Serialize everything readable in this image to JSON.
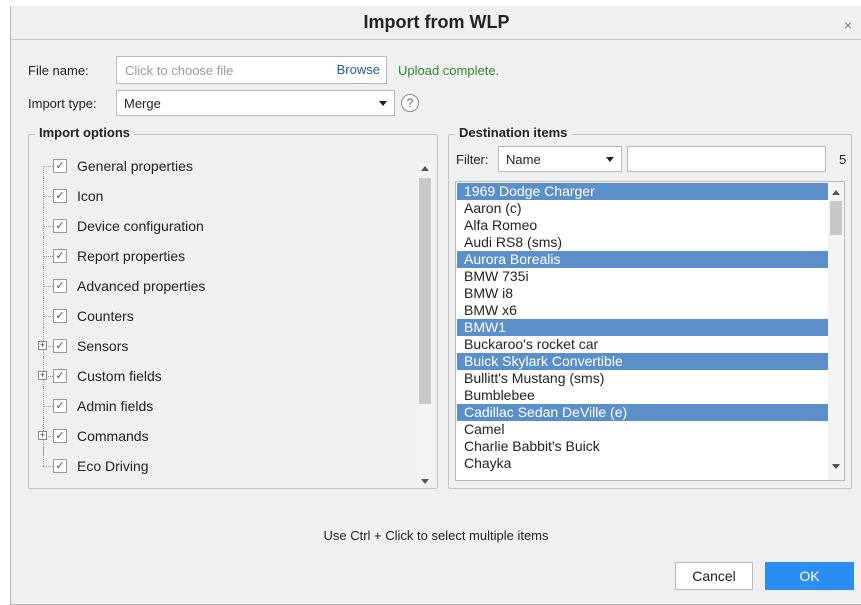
{
  "dialog": {
    "title": "Import from WLP",
    "close_label": "×"
  },
  "file": {
    "label": "File name:",
    "placeholder": "Click to choose file",
    "browse_label": "Browse",
    "status": "Upload complete."
  },
  "import_type": {
    "label": "Import type:",
    "value": "Merge",
    "help_label": "?"
  },
  "import_options": {
    "legend": "Import options",
    "items": [
      {
        "label": "General properties",
        "checked": true,
        "expandable": false
      },
      {
        "label": "Icon",
        "checked": true,
        "expandable": false
      },
      {
        "label": "Device configuration",
        "checked": true,
        "expandable": false
      },
      {
        "label": "Report properties",
        "checked": true,
        "expandable": false
      },
      {
        "label": "Advanced properties",
        "checked": true,
        "expandable": false
      },
      {
        "label": "Counters",
        "checked": true,
        "expandable": false
      },
      {
        "label": "Sensors",
        "checked": true,
        "expandable": true
      },
      {
        "label": "Custom fields",
        "checked": true,
        "expandable": true
      },
      {
        "label": "Admin fields",
        "checked": true,
        "expandable": false
      },
      {
        "label": "Commands",
        "checked": true,
        "expandable": true
      },
      {
        "label": "Eco Driving",
        "checked": true,
        "expandable": false
      }
    ]
  },
  "destination": {
    "legend": "Destination items",
    "filter_label": "Filter:",
    "filter_field": "Name",
    "filter_value": "",
    "count": "5",
    "items": [
      {
        "label": "1969 Dodge Charger",
        "selected": true
      },
      {
        "label": "Aaron (c)",
        "selected": false
      },
      {
        "label": "Alfa Romeo",
        "selected": false
      },
      {
        "label": "Audi RS8 (sms)",
        "selected": false
      },
      {
        "label": "Aurora Borealis",
        "selected": true
      },
      {
        "label": "BMW 735i",
        "selected": false
      },
      {
        "label": "BMW i8",
        "selected": false
      },
      {
        "label": "BMW x6",
        "selected": false
      },
      {
        "label": "BMW1",
        "selected": true
      },
      {
        "label": "Buckaroo's rocket car",
        "selected": false
      },
      {
        "label": "Buick Skylark Convertible",
        "selected": true
      },
      {
        "label": "Bullitt's Mustang (sms)",
        "selected": false
      },
      {
        "label": "Bumblebee",
        "selected": false
      },
      {
        "label": "Cadillac Sedan DeVille (e)",
        "selected": true
      },
      {
        "label": "Camel",
        "selected": false
      },
      {
        "label": "Charlie Babbit's Buick",
        "selected": false
      },
      {
        "label": "Chayka",
        "selected": false
      }
    ]
  },
  "footer": {
    "hint": "Use Ctrl + Click to select multiple items",
    "cancel_label": "Cancel",
    "ok_label": "OK"
  },
  "colors": {
    "accent": "#2c8ef2",
    "selection": "#5b8fc9",
    "success": "#2e8b2e",
    "link": "#1e5eab"
  }
}
